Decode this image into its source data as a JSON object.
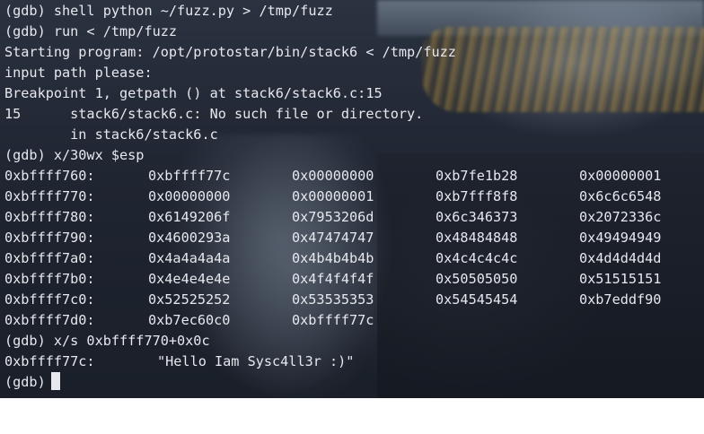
{
  "terminal": {
    "lines": [
      "(gdb) shell python ~/fuzz.py > /tmp/fuzz",
      "(gdb) run < /tmp/fuzz",
      "Starting program: /opt/protostar/bin/stack6 < /tmp/fuzz",
      "input path please:",
      "Breakpoint 1, getpath () at stack6/stack6.c:15",
      "15      stack6/stack6.c: No such file or directory.",
      "        in stack6/stack6.c",
      "(gdb) x/30wx $esp"
    ],
    "memory_rows": [
      [
        "0xbffff760:",
        "0xbffff77c",
        "0x00000000",
        "0xb7fe1b28",
        "0x00000001"
      ],
      [
        "0xbffff770:",
        "0x00000000",
        "0x00000001",
        "0xb7fff8f8",
        "0x6c6c6548"
      ],
      [
        "0xbffff780:",
        "0x6149206f",
        "0x7953206d",
        "0x6c346373",
        "0x2072336c"
      ],
      [
        "0xbffff790:",
        "0x4600293a",
        "0x47474747",
        "0x48484848",
        "0x49494949"
      ],
      [
        "0xbffff7a0:",
        "0x4a4a4a4a",
        "0x4b4b4b4b",
        "0x4c4c4c4c",
        "0x4d4d4d4d"
      ],
      [
        "0xbffff7b0:",
        "0x4e4e4e4e",
        "0x4f4f4f4f",
        "0x50505050",
        "0x51515151"
      ],
      [
        "0xbffff7c0:",
        "0x52525252",
        "0x53535353",
        "0x54545454",
        "0xb7eddf90"
      ],
      [
        "0xbffff7d0:",
        "0xb7ec60c0",
        "0xbffff77c",
        "",
        ""
      ]
    ],
    "string_cmd": "(gdb) x/s 0xbffff770+0x0c",
    "string_addr": "0xbffff77c:",
    "string_value": "\"Hello Iam Sysc4ll3r :)\"",
    "prompt": "(gdb)"
  },
  "colors": {
    "text": "#e6e8ee",
    "background": "#1f2531"
  }
}
